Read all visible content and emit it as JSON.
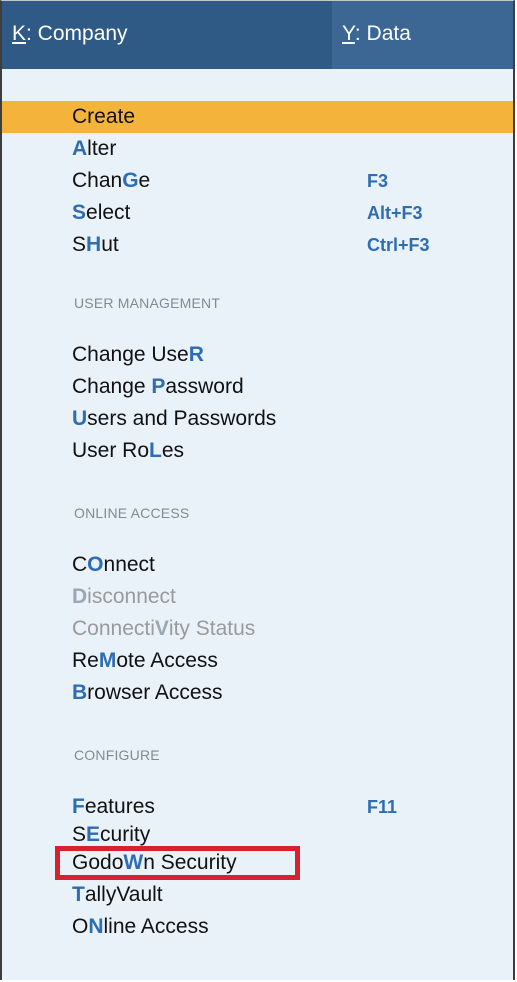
{
  "topbar": {
    "tab_k_key": "K",
    "tab_k_rest": ": Company",
    "tab_y_key": "Y",
    "tab_y_rest": ": Data"
  },
  "company_items": [
    {
      "pre": "Create",
      "key": "",
      "post": "",
      "shortcut": ""
    },
    {
      "pre": "",
      "key": "A",
      "post": "lter",
      "shortcut": ""
    },
    {
      "pre": "Chan",
      "key": "G",
      "post": "e",
      "shortcut": "F3"
    },
    {
      "pre": "",
      "key": "S",
      "post": "elect",
      "shortcut": "Alt+F3"
    },
    {
      "pre": "S",
      "key": "H",
      "post": "ut",
      "shortcut": "Ctrl+F3"
    }
  ],
  "sections": {
    "user_management": "USER MANAGEMENT",
    "online_access": "ONLINE ACCESS",
    "configure": "CONFIGURE"
  },
  "user_items": [
    {
      "pre": "Change Use",
      "key": "R",
      "post": ""
    },
    {
      "pre": "Change ",
      "key": "P",
      "post": "assword"
    },
    {
      "pre": "",
      "key": "U",
      "post": "sers and Passwords"
    },
    {
      "pre": "User Ro",
      "key": "L",
      "post": "es"
    }
  ],
  "online_items": [
    {
      "pre": "C",
      "key": "O",
      "post": "nnect"
    },
    {
      "pre": "",
      "key": "D",
      "post": "isconnect"
    },
    {
      "pre": "Connecti",
      "key": "V",
      "post": "ity Status"
    },
    {
      "pre": "Re",
      "key": "M",
      "post": "ote Access"
    },
    {
      "pre": "",
      "key": "B",
      "post": "rowser Access"
    }
  ],
  "configure_items": [
    {
      "pre": "",
      "key": "F",
      "post": "eatures",
      "shortcut": "F11"
    },
    {
      "pre": "S",
      "key": "E",
      "post": "curity",
      "shortcut": ""
    },
    {
      "pre": "Godo",
      "key": "W",
      "post": "n Security",
      "shortcut": ""
    },
    {
      "pre": "",
      "key": "T",
      "post": "allyVault",
      "shortcut": ""
    },
    {
      "pre": "O",
      "key": "N",
      "post": "line Access",
      "shortcut": ""
    }
  ],
  "colors": {
    "header_bg": "#2f5a86",
    "menu_bg": "#e9f1f9",
    "selected_bg": "#f4b43b",
    "hotkey": "#2e6db3",
    "highlight_box": "#d8202f"
  }
}
